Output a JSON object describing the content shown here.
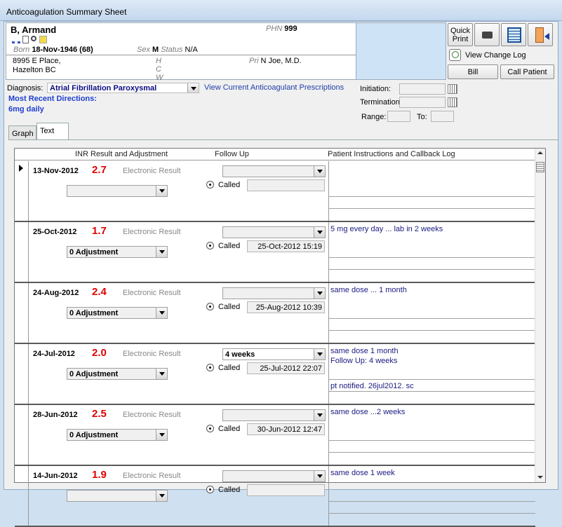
{
  "window_title": "Anticoagulation Summary Sheet",
  "patient": {
    "name": "B, Armand",
    "phn_label": "PHN",
    "phn": "999",
    "born_label": "Born",
    "born": "18-Nov-1946 (68)",
    "sex_label": "Sex",
    "sex": "M",
    "status_label": "Status",
    "status": "N/A",
    "address1": "8995 E Place,",
    "address2": "Hazelton BC",
    "phone_h": "H",
    "phone_c": "C",
    "phone_w": "W",
    "pri_label": "Pri",
    "pri": "N Joe, M.D."
  },
  "buttons": {
    "quick_print": "Quick Print",
    "view_change_log": "View Change Log",
    "bill": "Bill",
    "call_patient": "Call Patient"
  },
  "diagnosis_label": "Diagnosis:",
  "diagnosis": "Atrial Fibrillation Paroxysmal",
  "view_prescriptions": "View Current Anticoagulant Prescriptions",
  "directions_label": "Most Recent Directions:",
  "directions": "6mg daily",
  "initiation_label": "Initiation:",
  "termination_label": "Termination",
  "range_label": "Range:",
  "to_label": "To:",
  "tabs": [
    "Graph",
    "Text"
  ],
  "columns": [
    "INR Result and Adjustment",
    "Follow Up",
    "Patient Instructions and Callback Log"
  ],
  "rows": [
    {
      "date": "13-Nov-2012",
      "value": "2.7",
      "source": "Electronic Result",
      "adjustment": "",
      "follow": "",
      "called_label": "Called",
      "called": "",
      "instr1": "",
      "instr2": "",
      "note": ""
    },
    {
      "date": "25-Oct-2012",
      "value": "1.7",
      "source": "Electronic Result",
      "adjustment": "0 Adjustment",
      "follow": "",
      "called_label": "Called",
      "called": "25-Oct-2012 15:19",
      "instr1": "5 mg every day ... lab in 2 weeks",
      "instr2": "",
      "note": ""
    },
    {
      "date": "24-Aug-2012",
      "value": "2.4",
      "source": "Electronic Result",
      "adjustment": "0 Adjustment",
      "follow": "",
      "called_label": "Called",
      "called": "25-Aug-2012 10:39",
      "instr1": "same dose ...  1 month",
      "instr2": "",
      "note": ""
    },
    {
      "date": "24-Jul-2012",
      "value": "2.0",
      "source": "Electronic Result",
      "adjustment": "0 Adjustment",
      "follow": "4 weeks",
      "called_label": "Called",
      "called": "25-Jul-2012 22:07",
      "instr1": "same dose   1 month",
      "instr2": "Follow Up: 4 weeks",
      "note": "pt notified. 26jul2012. sc"
    },
    {
      "date": "28-Jun-2012",
      "value": "2.5",
      "source": "Electronic Result",
      "adjustment": "0 Adjustment",
      "follow": "",
      "called_label": "Called",
      "called": "30-Jun-2012 12:47",
      "instr1": "same dose ...2 weeks",
      "instr2": "",
      "note": ""
    },
    {
      "date": "14-Jun-2012",
      "value": "1.9",
      "source": "Electronic Result",
      "adjustment": "",
      "follow": "",
      "called_label": "Called",
      "called": "",
      "instr1": "same dose   1 week",
      "instr2": "",
      "note": ""
    }
  ]
}
